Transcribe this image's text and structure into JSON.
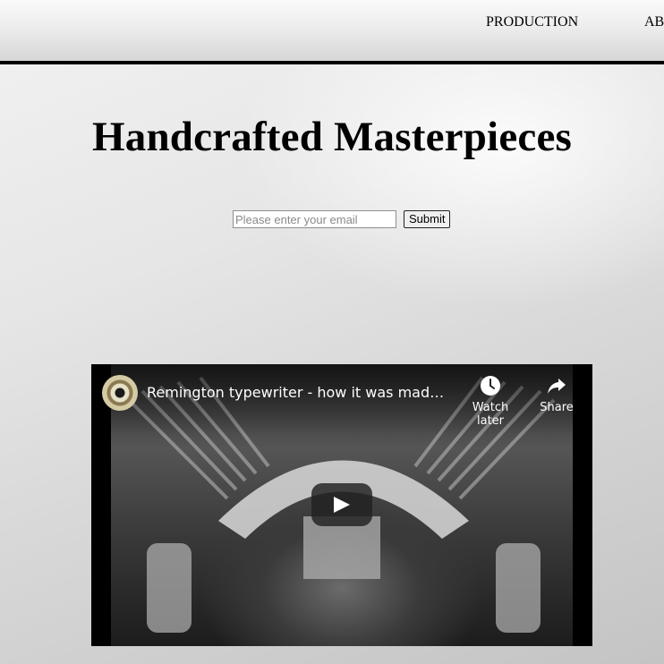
{
  "nav": {
    "links": [
      "PRODUCTION",
      "AB"
    ]
  },
  "hero": {
    "title": "Handcrafted Masterpieces"
  },
  "signup": {
    "email_placeholder": "Please enter your email",
    "submit_label": "Submit"
  },
  "video": {
    "title": "Remington typewriter - how it was made …",
    "watch_later_label": "Watch later",
    "share_label": "Share",
    "icons": [
      "channel-avatar",
      "clock-icon",
      "share-arrow-icon",
      "play-icon"
    ]
  },
  "colors": {
    "nav_border": "#000000",
    "text": "#000000",
    "video_bg": "#000000"
  }
}
